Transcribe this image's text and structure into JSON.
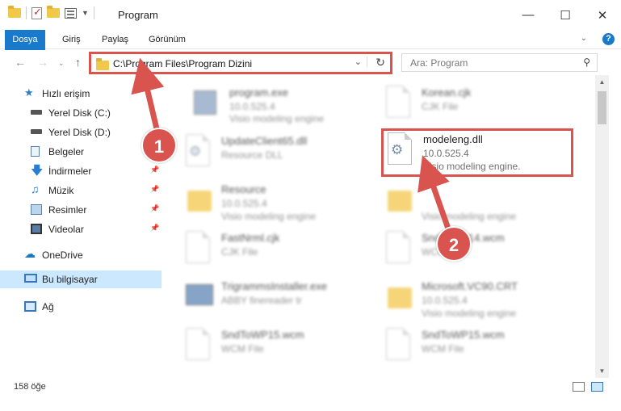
{
  "window": {
    "title": "Program"
  },
  "ribbon": {
    "tabs": [
      "Dosya",
      "Giriş",
      "Paylaş",
      "Görünüm"
    ]
  },
  "address": {
    "path": "C:\\Program Files\\Program Dizini"
  },
  "search": {
    "placeholder": "Ara: Program"
  },
  "sidebar": {
    "items": [
      {
        "label": "Hızlı erişim",
        "icon": "star-icon"
      },
      {
        "label": "Yerel Disk (C:)",
        "icon": "drive-icon"
      },
      {
        "label": "Yerel Disk (D:)",
        "icon": "drive-icon"
      },
      {
        "label": "Belgeler",
        "icon": "documents-icon"
      },
      {
        "label": "İndirmeler",
        "icon": "download-icon"
      },
      {
        "label": "Müzik",
        "icon": "music-icon"
      },
      {
        "label": "Resimler",
        "icon": "pictures-icon"
      },
      {
        "label": "Videolar",
        "icon": "videos-icon"
      },
      {
        "label": "OneDrive",
        "icon": "cloud-icon"
      },
      {
        "label": "Bu bilgisayar",
        "icon": "computer-icon"
      },
      {
        "label": "Ağ",
        "icon": "network-icon"
      }
    ]
  },
  "files": [
    {
      "name": "program.exe",
      "line2": "10.0.525.4",
      "line3": "Visio modeling engine",
      "kind": "exe"
    },
    {
      "name": "Korean.cjk",
      "line2": "CJK File",
      "line3": "",
      "kind": "doc"
    },
    {
      "name": "UpdateClient65.dll",
      "line2": "Resource DLL",
      "line3": "",
      "kind": "dll"
    },
    {
      "name": "modeleng.dll",
      "line2": "10.0.525.4",
      "line3": "Visio modeling engine.",
      "kind": "dll"
    },
    {
      "name": "Resource",
      "line2": "10.0.525.4",
      "line3": "Visio modeling engine",
      "kind": "folder"
    },
    {
      "name": "",
      "line2": "",
      "line3": "Visio modeling engine",
      "kind": "folder"
    },
    {
      "name": "FastNrml.cjk",
      "line2": "CJK File",
      "line3": "",
      "kind": "doc"
    },
    {
      "name": "SndToWP14.wcm",
      "line2": "WCM File",
      "line3": "",
      "kind": "doc"
    },
    {
      "name": "TrigrammsInstaller.exe",
      "line2": "ABBY finereader tr",
      "line3": "",
      "kind": "exe"
    },
    {
      "name": "Microsoft.VC90.CRT",
      "line2": "10.0.525.4",
      "line3": "Visio modeling engine",
      "kind": "folder"
    },
    {
      "name": "SndToWP15.wcm",
      "line2": "WCM File",
      "line3": "",
      "kind": "doc"
    },
    {
      "name": "SndToWP15.wcm",
      "line2": "WCM File",
      "line3": "",
      "kind": "doc"
    }
  ],
  "status": {
    "count": "158 öğe"
  },
  "callouts": [
    "1",
    "2"
  ],
  "colors": {
    "accent": "#1979ca",
    "highlight": "#d9534f"
  }
}
